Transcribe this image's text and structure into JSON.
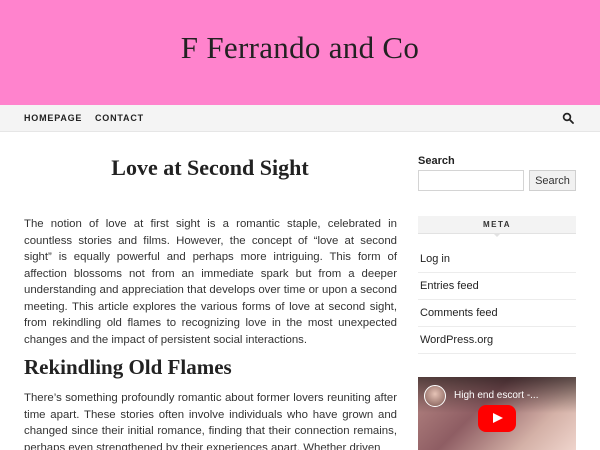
{
  "site": {
    "title": "F Ferrando and Co"
  },
  "nav": {
    "items": [
      {
        "label": "HOMEPAGE"
      },
      {
        "label": "CONTACT"
      }
    ],
    "search_icon": "search-icon"
  },
  "article": {
    "title": "Love at Second Sight",
    "intro": "The notion of love at first sight is a romantic staple, celebrated in countless stories and films. However, the concept of “love at second sight” is equally powerful and perhaps more intriguing. This form of affection blossoms not from an immediate spark but from a deeper understanding and appreciation that develops over time or upon a second meeting. This article explores the various forms of love at second sight, from rekindling old flames to recognizing love in the most unexpected changes and the impact of persistent social interactions.",
    "section_heading": "Rekindling Old Flames",
    "section_text": "There’s something profoundly romantic about former lovers reuniting after time apart. These stories often involve individuals who have grown and changed since their initial romance, finding that their connection remains, perhaps even strengthened by their experiences apart. Whether driven"
  },
  "sidebar": {
    "search": {
      "label": "Search",
      "placeholder": "",
      "button_label": "Search"
    },
    "meta": {
      "title": "META",
      "items": [
        {
          "label": "Log in"
        },
        {
          "label": "Entries feed"
        },
        {
          "label": "Comments feed"
        },
        {
          "label": "WordPress.org"
        }
      ]
    },
    "video": {
      "title": "High end escort -..."
    }
  },
  "colors": {
    "header_bg": "#ff83cd",
    "nav_bg": "#f4f4f4",
    "play_button": "#ff0000"
  }
}
